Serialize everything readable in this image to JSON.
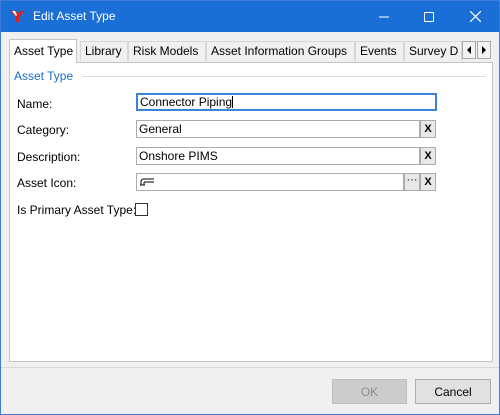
{
  "window": {
    "title": "Edit Asset Type",
    "controls": {
      "minimize": "minimize-icon",
      "maximize": "maximize-icon",
      "close": "close-icon"
    }
  },
  "tabs": [
    {
      "label": "Asset Type",
      "active": true
    },
    {
      "label": "Library",
      "active": false
    },
    {
      "label": "Risk Models",
      "active": false
    },
    {
      "label": "Asset Information Groups",
      "active": false
    },
    {
      "label": "Events",
      "active": false
    },
    {
      "label": "Survey D",
      "active": false
    }
  ],
  "group": {
    "title": "Asset Type"
  },
  "form": {
    "name_label": "Name:",
    "name_value": "Connector Piping",
    "category_label": "Category:",
    "category_value": "General",
    "description_label": "Description:",
    "description_value": "Onshore PIMS",
    "icon_label": "Asset Icon:",
    "icon_value": "pipe-icon",
    "primary_label": "Is Primary Asset Type:",
    "primary_checked": false,
    "clear_label": "X",
    "browse_label": "···"
  },
  "buttons": {
    "ok": "OK",
    "cancel": "Cancel"
  },
  "colors": {
    "titlebar": "#1a6fd6",
    "accent": "#1d6fc5",
    "focus": "#3b84d4"
  }
}
